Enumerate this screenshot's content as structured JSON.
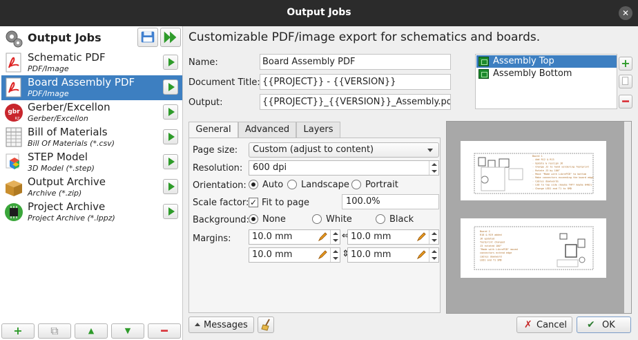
{
  "window": {
    "title": "Output Jobs",
    "close_glyph": "✕"
  },
  "left": {
    "title": "Output Jobs",
    "jobs": [
      {
        "name": "Schematic PDF",
        "type": "PDF/Image",
        "icon": "pdf-icon",
        "selected": false
      },
      {
        "name": "Board Assembly PDF",
        "type": "PDF/Image",
        "icon": "pdf-icon",
        "selected": true
      },
      {
        "name": "Gerber/Excellon",
        "type": "Gerber/Excellon",
        "icon": "gerber-icon",
        "selected": false
      },
      {
        "name": "Bill of Materials",
        "type": "Bill Of Materials (*.csv)",
        "icon": "spreadsheet-icon",
        "selected": false
      },
      {
        "name": "STEP Model",
        "type": "3D Model (*.step)",
        "icon": "cube-icon",
        "selected": false
      },
      {
        "name": "Output Archive",
        "type": "Archive (*.zip)",
        "icon": "box-icon",
        "selected": false
      },
      {
        "name": "Project Archive",
        "type": "Project Archive (*.lppz)",
        "icon": "chip-icon",
        "selected": false
      }
    ],
    "gerber_badge": "gbr",
    "gerber_badge_sub": "RZ",
    "bottom": {
      "add": "+",
      "copy": "⧉",
      "up": "▲",
      "down": "▼",
      "remove": "━"
    }
  },
  "heading": "Customizable PDF/image export for schematics and boards.",
  "form": {
    "name_label": "Name:",
    "name_value": "Board Assembly PDF",
    "title_label": "Document Title:",
    "title_value": "{{PROJECT}} - {{VERSION}}",
    "output_label": "Output:",
    "output_value": "{{PROJECT}}_{{VERSION}}_Assembly.pdf"
  },
  "boards": [
    {
      "label": "Assembly Top",
      "selected": true
    },
    {
      "label": "Assembly Bottom",
      "selected": false
    }
  ],
  "side_buttons": {
    "add": "+",
    "copy": "",
    "remove": "━"
  },
  "tabs": [
    {
      "label": "General",
      "active": true
    },
    {
      "label": "Advanced",
      "active": false
    },
    {
      "label": "Layers",
      "active": false
    }
  ],
  "general": {
    "page_size_label": "Page size:",
    "page_size_value": "Custom (adjust to content)",
    "resolution_label": "Resolution:",
    "resolution_value": "600 dpi",
    "orientation_label": "Orientation:",
    "orientation_options": [
      "Auto",
      "Landscape",
      "Portrait"
    ],
    "orientation_selected": "Auto",
    "scale_label": "Scale factor:",
    "fit_to_page_label": "Fit to page",
    "fit_to_page_checked": true,
    "check_glyph": "✓",
    "scale_value": "100.0%",
    "background_label": "Background:",
    "background_options": [
      "None",
      "White",
      "Black"
    ],
    "background_selected": "None",
    "margins_label": "Margins:",
    "margins": {
      "left": "10.0 mm",
      "right": "10.0 mm",
      "top": "10.0 mm",
      "bottom": "10.0 mm"
    },
    "link_h": "⇔",
    "link_v": "⇕"
  },
  "preview": {
    "page1_notes": "Board 1\n- Add R12 & R13\n- Update & realign J6\n- Change J2 to hand soldering footprint\n- Rotate J3 by 180°\n- Move \"Made with LibrePCB\" to bottom\n- Make connectors exceeding the board edge\n- Cables downwards\n- LED to top side (maybe THT? maybe 0402)\n- Change LED1 and T1 to SMD",
    "page2_notes": "Board 2\nR18 & R19 added\nJ6 updated\nfootprint changed\nJ3 rotated 180°\n\"Made with LibrePCB\" moved\nconnectors extend edge\ncables downward\nLED1 and T1 SMD"
  },
  "footer": {
    "messages": "Messages",
    "clear_icon": "broom-icon",
    "cancel": "Cancel",
    "ok": "OK",
    "cancel_glyph": "✗",
    "ok_glyph": "✔"
  },
  "colors": {
    "selection": "#3d7fc1",
    "run_green": "#2e9b2a",
    "remove_red": "#d9343b",
    "titlebar": "#2b2b2b"
  }
}
